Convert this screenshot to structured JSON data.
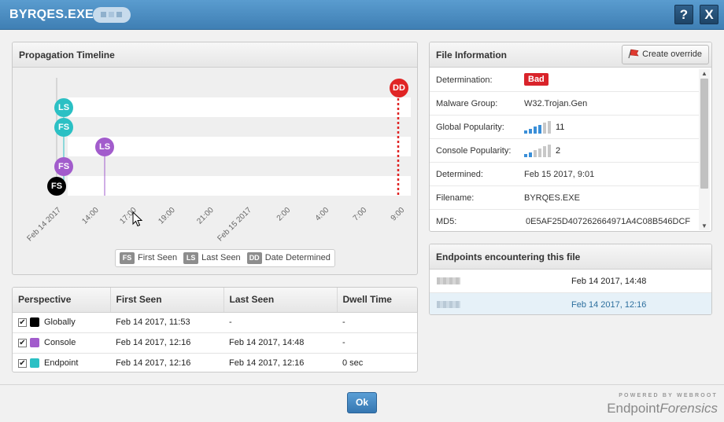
{
  "window": {
    "title": "BYRQES.EXE",
    "help_label": "?",
    "close_label": "X"
  },
  "timeline": {
    "title": "Propagation Timeline",
    "markers": {
      "dd": "DD",
      "endpoint_last": "LS",
      "endpoint_first": "FS",
      "console_last": "LS",
      "console_first": "FS",
      "global_first": "FS"
    },
    "ticks": [
      "Feb 14 2017",
      "14:00",
      "17:00",
      "19:00",
      "21:00",
      "Feb 15 2017",
      "2:00",
      "4:00",
      "7:00",
      "9:00"
    ],
    "legend": [
      {
        "key": "FS",
        "label": "First Seen"
      },
      {
        "key": "LS",
        "label": "Last Seen"
      },
      {
        "key": "DD",
        "label": "Date Determined"
      }
    ],
    "colors": {
      "determined": "#e02424",
      "endpoint": "#2bc0c4",
      "console": "#a25ccc",
      "global": "#000000"
    }
  },
  "perspective": {
    "headers": [
      "Perspective",
      "First Seen",
      "Last Seen",
      "Dwell Time"
    ],
    "rows": [
      {
        "name": "Globally",
        "first": "Feb 14 2017, 11:53",
        "last": "-",
        "dwell": "-",
        "checked": "✔"
      },
      {
        "name": "Console",
        "first": "Feb 14 2017, 12:16",
        "last": "Feb 14 2017, 14:48",
        "dwell": "-",
        "checked": "✔"
      },
      {
        "name": "Endpoint",
        "first": "Feb 14 2017, 12:16",
        "last": "Feb 14 2017, 12:16",
        "dwell": "0 sec",
        "checked": "✔"
      }
    ]
  },
  "file_info": {
    "title": "File Information",
    "override_label": "Create override",
    "determination_label": "Determination:",
    "determination_value": "Bad",
    "malware_group_label": "Malware Group:",
    "malware_group_value": "W32.Trojan.Gen",
    "global_pop_label": "Global Popularity:",
    "global_pop_value": "11",
    "global_pop_level": 0.6,
    "console_pop_label": "Console Popularity:",
    "console_pop_value": "2",
    "console_pop_level": 0.4,
    "determined_label": "Determined:",
    "determined_value": "Feb 15 2017, 9:01",
    "filename_label": "Filename:",
    "filename_value": "BYRQES.EXE",
    "md5_label": "MD5:",
    "md5_value": "0E5AF25D407262664971A4C08B546DCF"
  },
  "endpoints": {
    "title": "Endpoints encountering this file",
    "rows": [
      {
        "date": "Feb 14 2017, 14:48",
        "selected": false
      },
      {
        "date": "Feb 14 2017, 12:16",
        "selected": true
      }
    ]
  },
  "footer": {
    "ok_label": "Ok",
    "brand_small": "POWERED BY WEBROOT",
    "brand_plain": "Endpoint",
    "brand_italic": "Forensics"
  }
}
